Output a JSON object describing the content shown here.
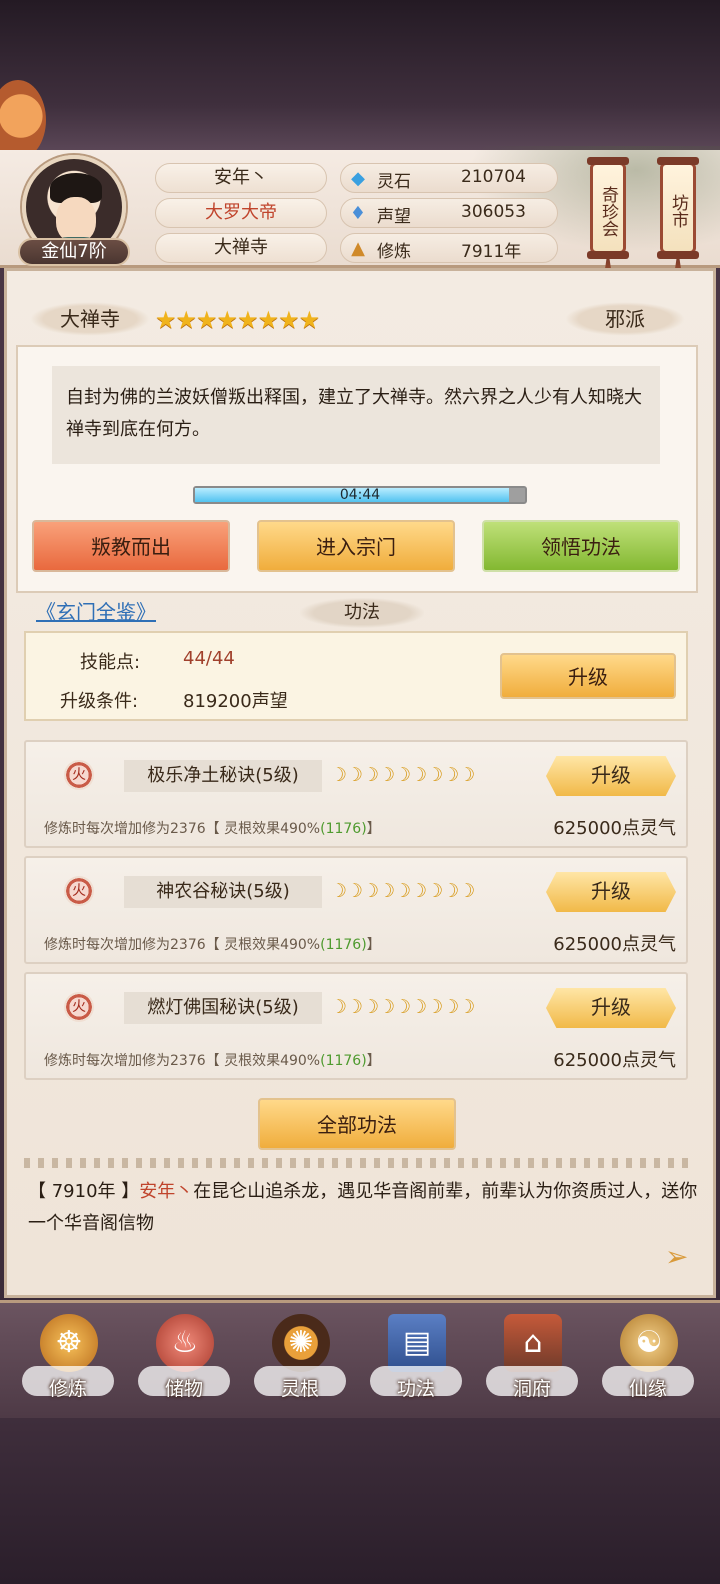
{
  "header": {
    "player_name": "安年丶",
    "title": "大罗大帝",
    "sect": "大禅寺",
    "rank": "金仙7阶",
    "stats": [
      {
        "icon": "spirit-stone-icon",
        "label": "灵石",
        "value": "210704"
      },
      {
        "icon": "fame-crystal-icon",
        "label": "声望",
        "value": "306053"
      },
      {
        "icon": "cultivate-icon",
        "label": "修炼",
        "value": "7911年"
      }
    ],
    "scroll_buttons": [
      "奇珍会",
      "坊市"
    ]
  },
  "sect": {
    "name": "大禅寺",
    "stars": "★★★★★★★★",
    "alignment": "邪派",
    "description": "自封为佛的兰波妖僧叛出释国，建立了大禅寺。然六界之人少有人知晓大禅寺到底在何方。",
    "timer": "04:44",
    "progress": 0.95,
    "buttons": {
      "leave": "叛教而出",
      "enter": "进入宗门",
      "learn": "领悟功法"
    }
  },
  "gongfa": {
    "link": "《玄门全鉴》",
    "section_title": "功法",
    "skill_points_label": "技能点:",
    "skill_points_value": "44/44",
    "upgrade_cond_label": "升级条件:",
    "upgrade_cond_value": "819200声望",
    "upgrade_button": "升级",
    "skills": [
      {
        "element": "火",
        "name": "极乐净土秘诀(5级)",
        "moons": "☽☽☽☽☽☽☽☽☽",
        "button": "升级",
        "note_a": "修炼时每次增加修为2376【 灵根效果490%",
        "note_b": "(1176)",
        "note_c": "】",
        "cost": "625000点灵气"
      },
      {
        "element": "火",
        "name": "神农谷秘诀(5级)",
        "moons": "☽☽☽☽☽☽☽☽☽",
        "button": "升级",
        "note_a": "修炼时每次增加修为2376【 灵根效果490%",
        "note_b": "(1176)",
        "note_c": "】",
        "cost": "625000点灵气"
      },
      {
        "element": "火",
        "name": "燃灯佛国秘诀(5级)",
        "moons": "☽☽☽☽☽☽☽☽☽",
        "button": "升级",
        "note_a": "修炼时每次增加修为2376【 灵根效果490%",
        "note_b": "(1176)",
        "note_c": "】",
        "cost": "625000点灵气"
      }
    ],
    "all_button": "全部功法"
  },
  "log": {
    "year": "【 7910年 】",
    "name": "安年丶",
    "text": "在昆仑山追杀龙，遇见华音阁前辈，前辈认为你资质过人，送你一个华音阁信物"
  },
  "nav": [
    {
      "icon": "meditate-icon",
      "label": "修炼"
    },
    {
      "icon": "bag-icon",
      "label": "储物"
    },
    {
      "icon": "spirit-root-icon",
      "label": "灵根"
    },
    {
      "icon": "book-icon",
      "label": "功法"
    },
    {
      "icon": "cave-icon",
      "label": "洞府"
    },
    {
      "icon": "gourd-icon",
      "label": "仙缘"
    }
  ],
  "colors": {
    "accent_red": "#c0442c",
    "link_blue": "#2f6fb6",
    "gold": "#f0ad3c",
    "green": "#83b831"
  }
}
